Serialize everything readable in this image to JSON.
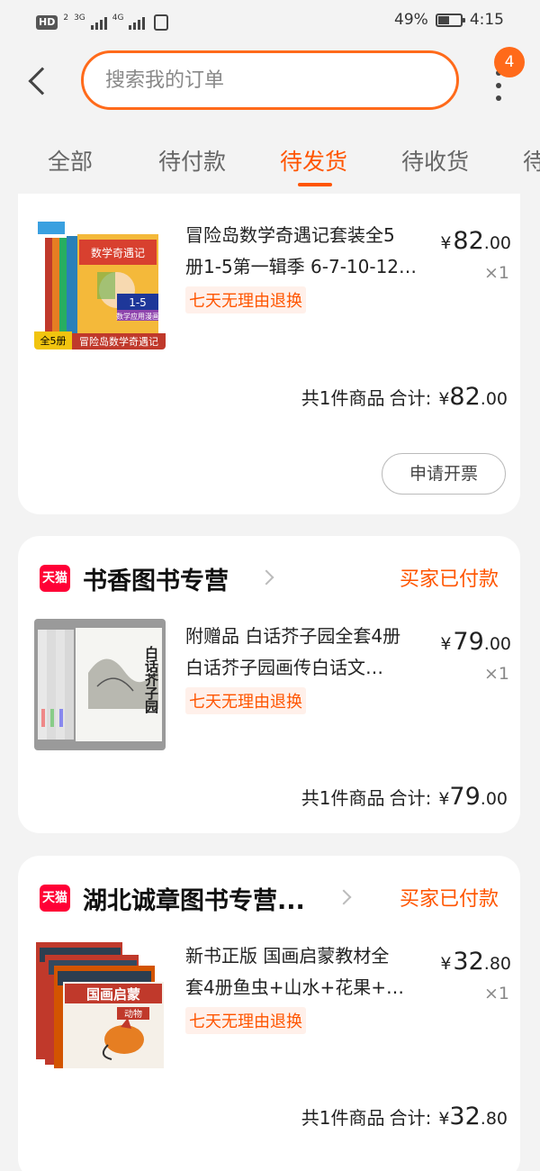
{
  "status_bar": {
    "hd": "HD",
    "sim": "2",
    "net1": "3G",
    "net2": "4G",
    "battery": "49%",
    "time": "4:15"
  },
  "header": {
    "search_placeholder": "搜索我的订单",
    "badge_count": "4"
  },
  "tabs": [
    {
      "label": "全部"
    },
    {
      "label": "待付款"
    },
    {
      "label": "待发货"
    },
    {
      "label": "待收货"
    },
    {
      "label": "待"
    }
  ],
  "active_tab": "待发货",
  "orders": [
    {
      "shop_name": "",
      "status": "",
      "item": {
        "title_line1": "冒险岛数学奇遇记套装全5",
        "title_line2": "册1-5第一辑季 6-7-10-12…",
        "tag": "七天无理由退换",
        "price_currency": "¥",
        "price_int": "82",
        "price_dec": ".00",
        "quantity": "×1",
        "thumb_label_top": "数学奇遇记",
        "thumb_label_bottom": "冒险岛数学奇遇记",
        "thumb_set": "全5册",
        "thumb_range": "1-5",
        "thumb_sub": "数学应用漫画"
      },
      "summary": {
        "count_label": "共1件商品",
        "total_label": "合计:",
        "currency": "¥",
        "total_int": "82",
        "total_dec": ".00"
      },
      "invoice_button": "申请开票"
    },
    {
      "shop_name": "书香图书专营",
      "shop_logo": "天猫",
      "status": "买家已付款",
      "item": {
        "title_line1": "附赠品 白话芥子园全套4册",
        "title_line2": "白话芥子园画传白话文…",
        "tag": "七天无理由退换",
        "price_currency": "¥",
        "price_int": "79",
        "price_dec": ".00",
        "quantity": "×1",
        "thumb_label_top": "白话芥子园"
      },
      "summary": {
        "count_label": "共1件商品",
        "total_label": "合计:",
        "currency": "¥",
        "total_int": "79",
        "total_dec": ".00"
      }
    },
    {
      "shop_name": "湖北诚章图书专营...",
      "shop_logo": "天猫",
      "status": "买家已付款",
      "item": {
        "title_line1": "新书正版 国画启蒙教材全",
        "title_line2": "套4册鱼虫+山水+花果+…",
        "tag": "七天无理由退换",
        "price_currency": "¥",
        "price_int": "32",
        "price_dec": ".80",
        "quantity": "×1",
        "thumb_label_top": "国画启蒙",
        "thumb_label_bottom": "动物"
      },
      "summary": {
        "count_label": "共1件商品",
        "total_label": "合计:",
        "currency": "¥",
        "total_int": "32",
        "total_dec": ".80"
      }
    }
  ],
  "colors": {
    "accent": "#ff5500",
    "search_border": "#ff6a1a",
    "tmall_red": "#ff0036",
    "tag_bg": "#fff0ea"
  },
  "icons": [
    "back-arrow-icon",
    "more-vertical-icon",
    "tmall-logo-icon",
    "chevron-right-icon",
    "signal-icon",
    "vibrate-icon",
    "battery-icon"
  ]
}
